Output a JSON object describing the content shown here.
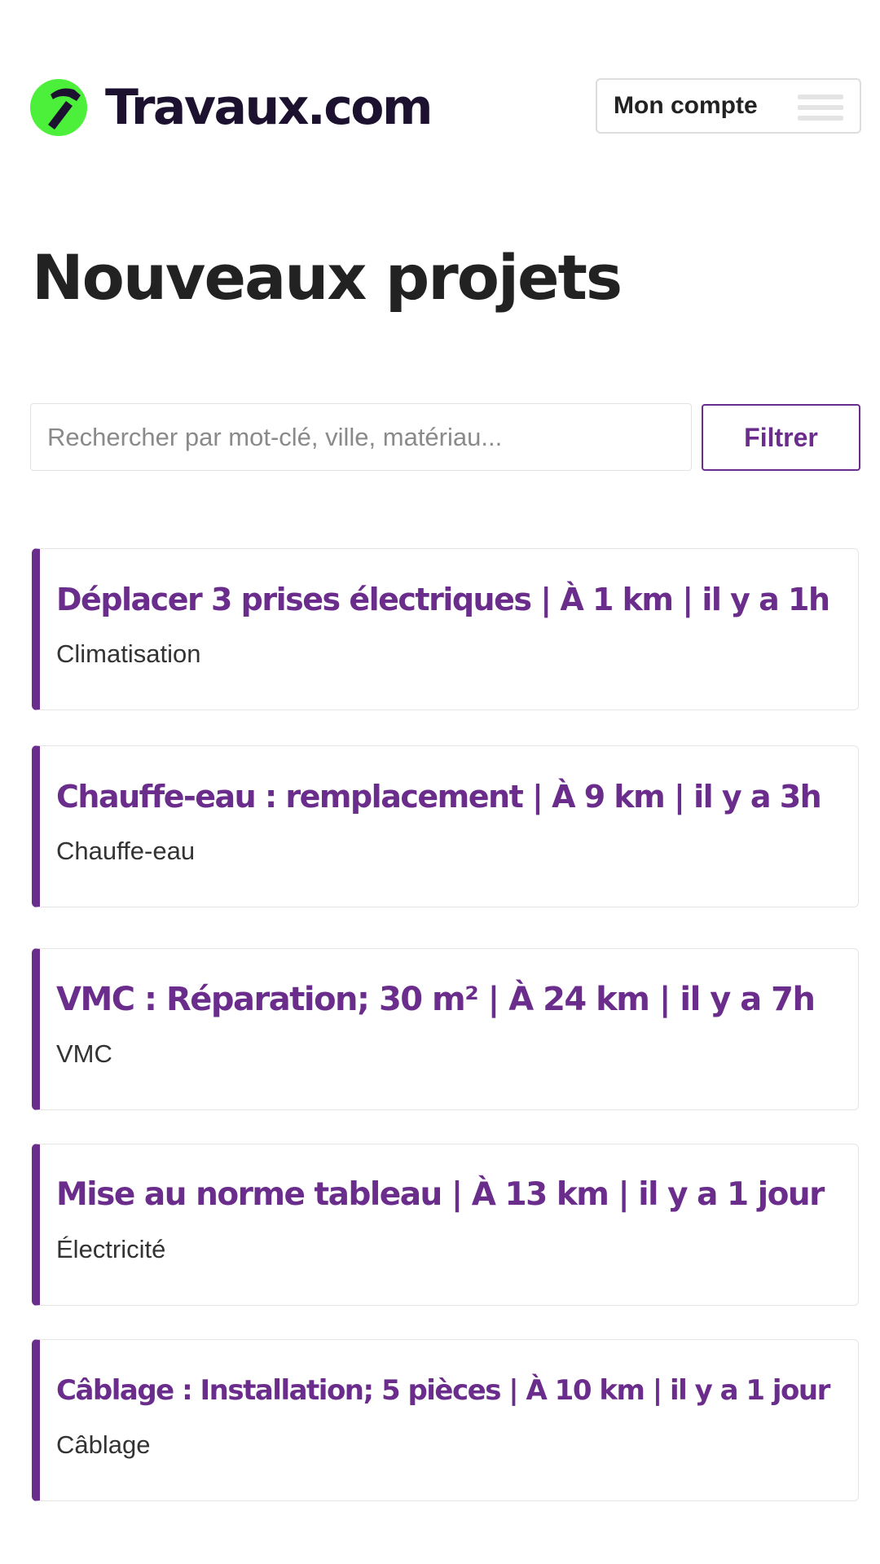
{
  "header": {
    "logo_text": "Travaux.com",
    "account_label": "Mon compte"
  },
  "page": {
    "title": "Nouveaux projets"
  },
  "search": {
    "placeholder": "Rechercher par mot-clé, ville, matériau...",
    "value": "",
    "filter_label": "Filtrer"
  },
  "projects": [
    {
      "title": "Déplacer 3 prises électriques | À 1 km | il y a 1h",
      "category": "Climatisation"
    },
    {
      "title": "Chauffe-eau : remplacement | À 9 km | il y a 3h",
      "category": "Chauffe-eau"
    },
    {
      "title": "VMC : Réparation; 30 m² | À 24 km | il y a 7h",
      "category": "VMC"
    },
    {
      "title": "Mise au norme tableau | À 13 km | il y a 1 jour",
      "category": "Électricité"
    },
    {
      "title": "Câblage : Installation; 5 pièces | À 10 km | il y a 1 jour",
      "category": "Câblage"
    }
  ],
  "colors": {
    "accent": "#6b2d8c",
    "logo_circle": "#4cf03a",
    "logo_text": "#1d1130",
    "text": "#222222"
  },
  "icons": {
    "logo": "hammer-icon",
    "menu": "hamburger-icon"
  }
}
